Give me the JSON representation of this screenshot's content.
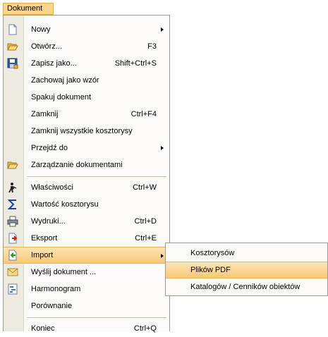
{
  "menubar": {
    "title": "Dokument"
  },
  "menu": {
    "items": [
      {
        "label": "Nowy",
        "shortcut": "",
        "icon": "new-document-icon",
        "submenu": true
      },
      {
        "label": "Otwórz...",
        "shortcut": "F3",
        "icon": "folder-open-icon"
      },
      {
        "label": "Zapisz jako...",
        "shortcut": "Shift+Ctrl+S",
        "icon": "save-as-icon"
      },
      {
        "label": "Zachowaj jako wzór",
        "shortcut": ""
      },
      {
        "label": "Spakuj dokument",
        "shortcut": ""
      },
      {
        "label": "Zamknij",
        "shortcut": "Ctrl+F4"
      },
      {
        "label": "Zamknij wszystkie kosztorysy",
        "shortcut": ""
      },
      {
        "label": "Przejdź do",
        "shortcut": "",
        "submenu": true
      },
      {
        "label": "Zarządzanie dokumentami",
        "shortcut": "",
        "icon": "folder-open-icon"
      },
      {
        "label": "Właściwości",
        "shortcut": "Ctrl+W",
        "icon": "properties-figure-icon"
      },
      {
        "label": "Wartość kosztorysu",
        "shortcut": "",
        "icon": "sigma-icon"
      },
      {
        "label": "Wydruki...",
        "shortcut": "Ctrl+D",
        "icon": "printer-icon"
      },
      {
        "label": "Eksport",
        "shortcut": "Ctrl+E",
        "icon": "export-icon"
      },
      {
        "label": "Import",
        "shortcut": "",
        "icon": "import-icon",
        "submenu": true,
        "highlighted": true
      },
      {
        "label": "Wyślij dokument ...",
        "shortcut": "",
        "icon": "envelope-icon"
      },
      {
        "label": "Harmonogram",
        "shortcut": "",
        "icon": "schedule-icon"
      },
      {
        "label": "Porównanie",
        "shortcut": ""
      },
      {
        "label": "Koniec",
        "shortcut": "Ctrl+Q"
      }
    ]
  },
  "submenu": {
    "items": [
      {
        "label": "Kosztorysów"
      },
      {
        "label": "Plików PDF",
        "highlighted": true
      },
      {
        "label": "Katalogów / Cenników obiektów"
      }
    ]
  },
  "colors": {
    "highlight_top": "#fde4b4",
    "highlight_bottom": "#f9c879",
    "highlight_border": "#e9b45c",
    "menu_bg": "#fbfaf6",
    "gutter_bg": "#edeae0"
  }
}
